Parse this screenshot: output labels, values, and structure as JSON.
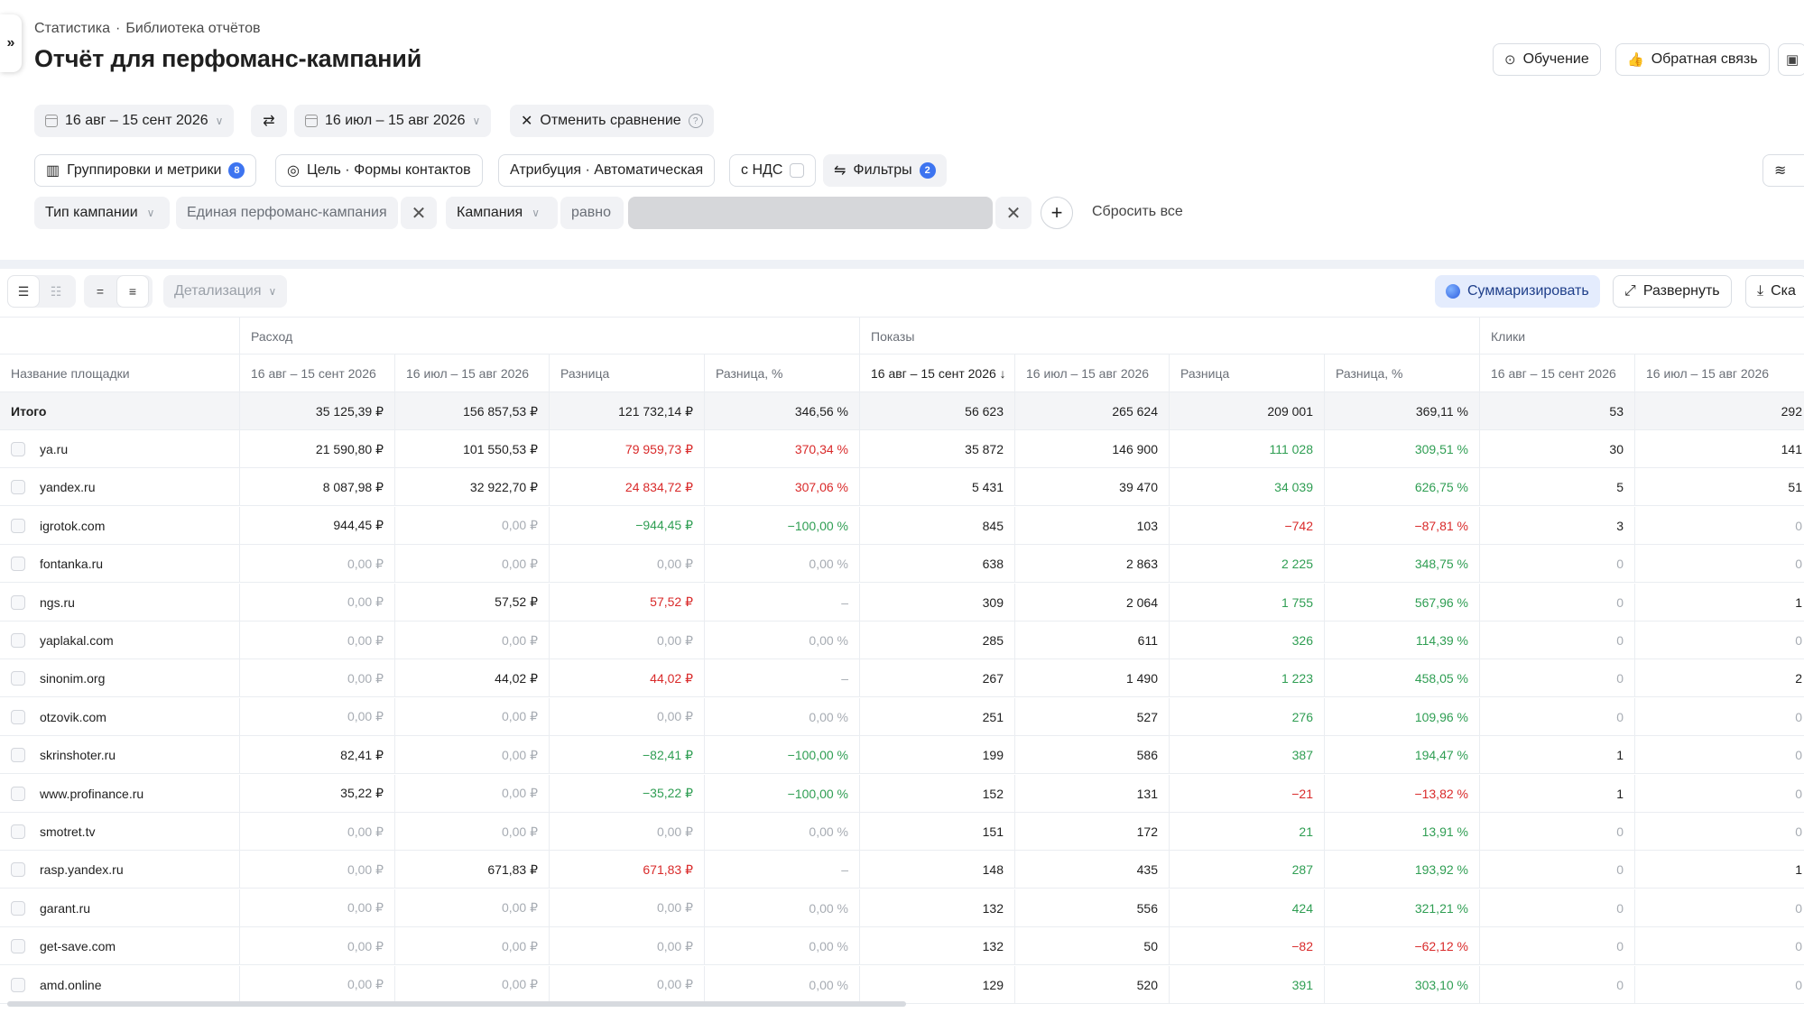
{
  "breadcrumb": {
    "item1": "Статистика",
    "sep": "·",
    "item2": "Библиотека отчётов"
  },
  "page_title": "Отчёт для перфоманс-кампаний",
  "header_buttons": {
    "learning": "Обучение",
    "feedback": "Обратная связь"
  },
  "period": {
    "current": "16 авг – 15 сент 2026",
    "compare": "16 июл – 15 авг 2026",
    "cancel_compare": "Отменить сравнение"
  },
  "settings": {
    "groupings": "Группировки и метрики",
    "groupings_count": "8",
    "goal": "Цель · Формы контактов",
    "attribution": "Атрибуция · Автоматическая",
    "vat": "с НДС",
    "filters": "Фильтры",
    "filters_count": "2"
  },
  "filter_row": {
    "type_label": "Тип кампании",
    "type_value": "Единая перфоманс-кампания",
    "campaign_label": "Кампания",
    "campaign_op": "равно",
    "reset": "Сбросить все"
  },
  "toolbar": {
    "detail": "Детализация",
    "summarize": "Суммаризировать",
    "expand": "Развернуть",
    "download": "Ска"
  },
  "table": {
    "groups": {
      "spend": "Расход",
      "impressions": "Показы",
      "clicks": "Клики"
    },
    "columns": [
      "Название площадки",
      "16 авг – 15 сент 2026",
      "16 июл – 15 авг 2026",
      "Разница",
      "Разница, %",
      "16 авг – 15 сент 2026 ↓",
      "16 июл – 15 авг 2026",
      "Разница",
      "Разница, %",
      "16 авг – 15 сент 2026",
      "16 июл – 15 авг 2026"
    ],
    "total": [
      "Итого",
      "35 125,39 ₽",
      "156 857,53 ₽",
      "121 732,14 ₽",
      "346,56 %",
      "56 623",
      "265 624",
      "209 001",
      "369,11 %",
      "53",
      "292"
    ],
    "rows": [
      [
        "ya.ru",
        "21 590,80 ₽",
        "101 550,53 ₽",
        "79 959,73 ₽",
        "370,34 %",
        "35 872",
        "146 900",
        "111 028",
        "309,51 %",
        "30",
        "141"
      ],
      [
        "yandex.ru",
        "8 087,98 ₽",
        "32 922,70 ₽",
        "24 834,72 ₽",
        "307,06 %",
        "5 431",
        "39 470",
        "34 039",
        "626,75 %",
        "5",
        "51"
      ],
      [
        "igrotok.com",
        "944,45 ₽",
        "0,00 ₽",
        "−944,45 ₽",
        "−100,00 %",
        "845",
        "103",
        "−742",
        "−87,81 %",
        "3",
        "0"
      ],
      [
        "fontanka.ru",
        "0,00 ₽",
        "0,00 ₽",
        "0,00 ₽",
        "0,00 %",
        "638",
        "2 863",
        "2 225",
        "348,75 %",
        "0",
        "0"
      ],
      [
        "ngs.ru",
        "0,00 ₽",
        "57,52 ₽",
        "57,52 ₽",
        "–",
        "309",
        "2 064",
        "1 755",
        "567,96 %",
        "0",
        "1"
      ],
      [
        "yaplakal.com",
        "0,00 ₽",
        "0,00 ₽",
        "0,00 ₽",
        "0,00 %",
        "285",
        "611",
        "326",
        "114,39 %",
        "0",
        "0"
      ],
      [
        "sinonim.org",
        "0,00 ₽",
        "44,02 ₽",
        "44,02 ₽",
        "–",
        "267",
        "1 490",
        "1 223",
        "458,05 %",
        "0",
        "2"
      ],
      [
        "otzovik.com",
        "0,00 ₽",
        "0,00 ₽",
        "0,00 ₽",
        "0,00 %",
        "251",
        "527",
        "276",
        "109,96 %",
        "0",
        "0"
      ],
      [
        "skrinshoter.ru",
        "82,41 ₽",
        "0,00 ₽",
        "−82,41 ₽",
        "−100,00 %",
        "199",
        "586",
        "387",
        "194,47 %",
        "1",
        "0"
      ],
      [
        "www.profinance.ru",
        "35,22 ₽",
        "0,00 ₽",
        "−35,22 ₽",
        "−100,00 %",
        "152",
        "131",
        "−21",
        "−13,82 %",
        "1",
        "0"
      ],
      [
        "smotret.tv",
        "0,00 ₽",
        "0,00 ₽",
        "0,00 ₽",
        "0,00 %",
        "151",
        "172",
        "21",
        "13,91 %",
        "0",
        "0"
      ],
      [
        "rasp.yandex.ru",
        "0,00 ₽",
        "671,83 ₽",
        "671,83 ₽",
        "–",
        "148",
        "435",
        "287",
        "193,92 %",
        "0",
        "1"
      ],
      [
        "garant.ru",
        "0,00 ₽",
        "0,00 ₽",
        "0,00 ₽",
        "0,00 %",
        "132",
        "556",
        "424",
        "321,21 %",
        "0",
        "0"
      ],
      [
        "get-save.com",
        "0,00 ₽",
        "0,00 ₽",
        "0,00 ₽",
        "0,00 %",
        "132",
        "50",
        "−82",
        "−62,12 %",
        "0",
        "0"
      ],
      [
        "amd.online",
        "0,00 ₽",
        "0,00 ₽",
        "0,00 ₽",
        "0,00 %",
        "129",
        "520",
        "391",
        "303,10 %",
        "0",
        "0"
      ]
    ]
  },
  "colors": {
    "positive": "#2f9e53",
    "negative": "#d92a2a",
    "zero": "#a7acb3",
    "accent": "#3d74f0"
  }
}
